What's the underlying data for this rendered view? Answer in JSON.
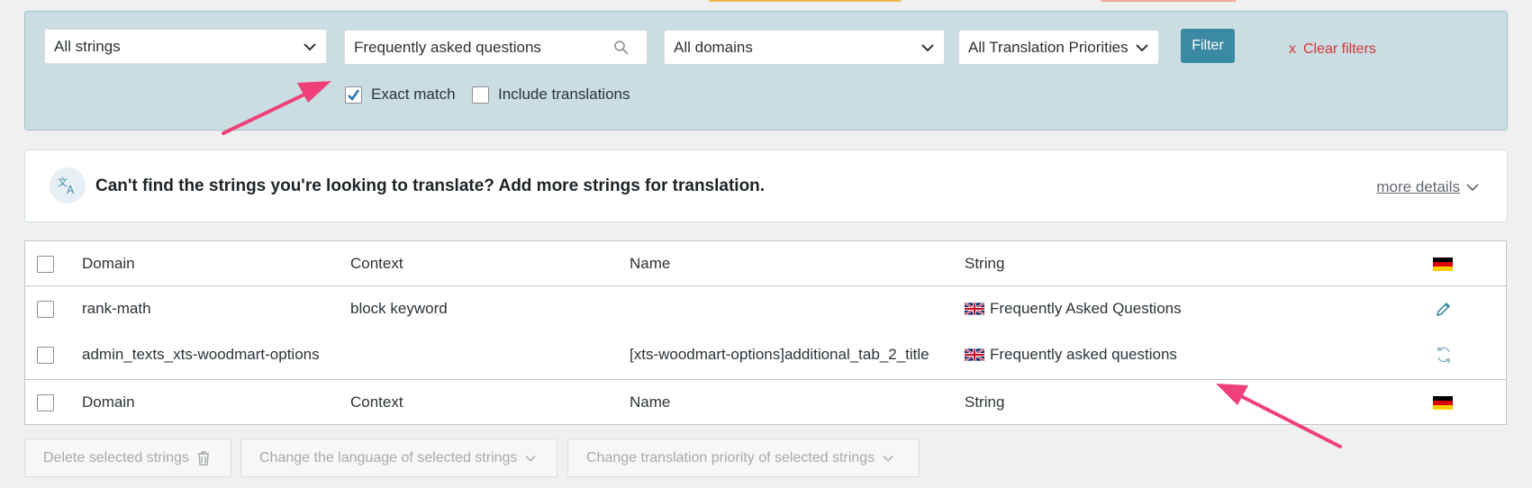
{
  "filters": {
    "strings_select": "All strings",
    "search_value": "Frequently asked questions",
    "domains_select": "All domains",
    "priorities_select": "All Translation Priorities",
    "filter_button": "Filter",
    "clear_icon": "x",
    "clear_label": "Clear filters",
    "exact_match": {
      "label": "Exact match",
      "checked": true
    },
    "include_translations": {
      "label": "Include translations",
      "checked": false
    }
  },
  "notice": {
    "icon": "translate-icon",
    "message": "Can't find the strings you're looking to translate? Add more strings for translation.",
    "more_details": "more details"
  },
  "table": {
    "columns": {
      "domain": "Domain",
      "context": "Context",
      "name": "Name",
      "string": "String"
    },
    "rows": [
      {
        "domain": "rank-math",
        "context": "block keyword",
        "name": "",
        "string": "Frequently Asked Questions",
        "action": "edit-pencil-icon"
      },
      {
        "domain": "admin_texts_xts-woodmart-options",
        "context": "",
        "name": "[xts-woodmart-options]additional_tab_2_title",
        "string": "Frequently asked questions",
        "action": "refresh-icon"
      }
    ]
  },
  "bulk_actions": {
    "delete": "Delete selected strings",
    "change_language": "Change the language of selected strings",
    "change_priority": "Change translation priority of selected strings"
  },
  "colors": {
    "panel_bg": "#c9dde3",
    "accent": "#3a8aa3",
    "clear": "#d63638",
    "annotation_arrow": "#f0407a"
  }
}
